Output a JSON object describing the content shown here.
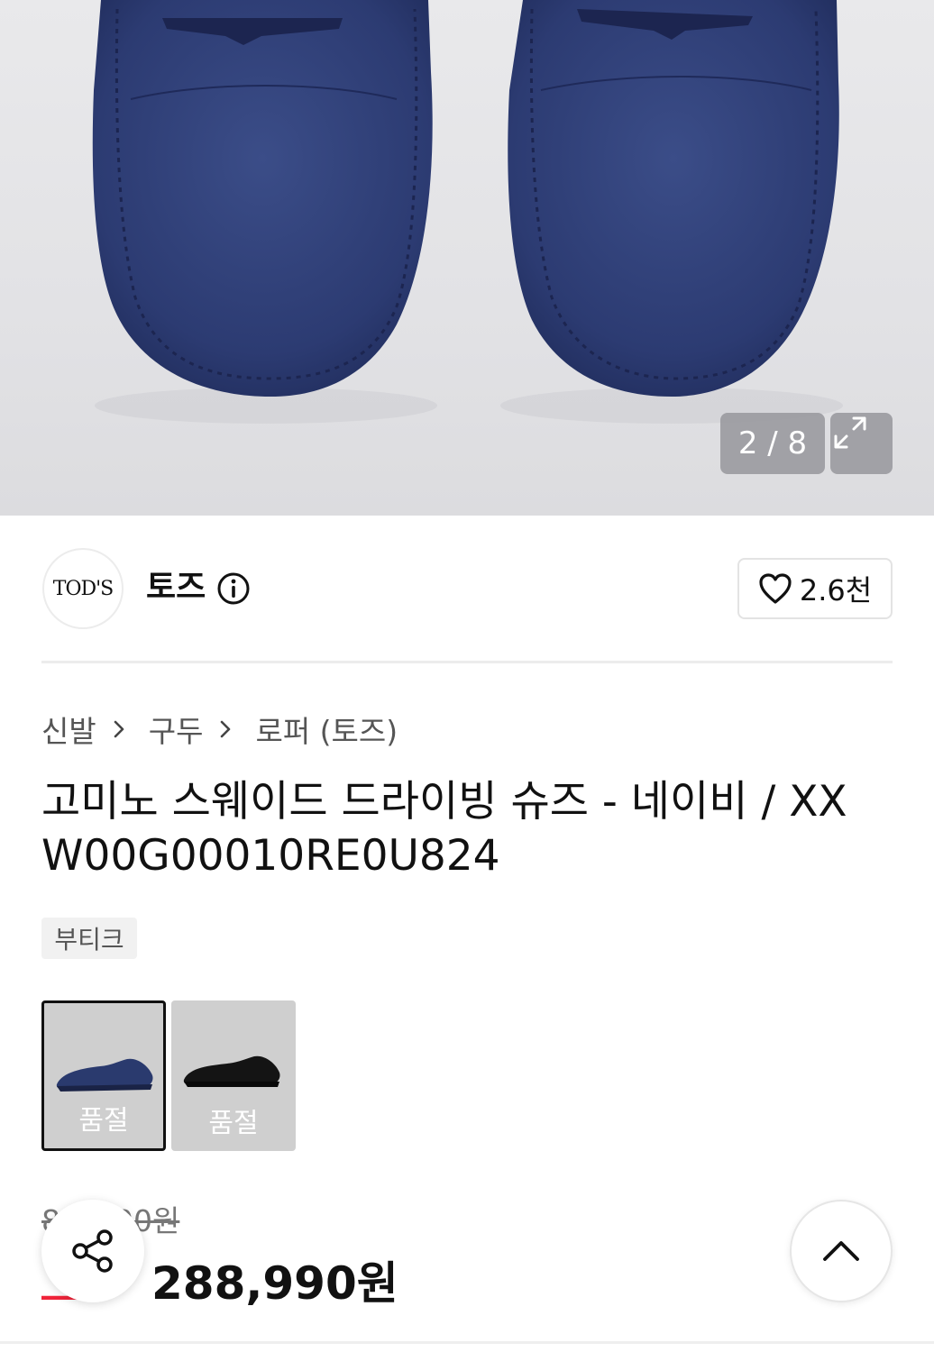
{
  "gallery": {
    "counter": "2 / 8",
    "expand_icon": "expand-arrows-icon",
    "image_alt": "navy suede loafers"
  },
  "brand": {
    "logo_text": "TOD'S",
    "name": "토즈",
    "info_icon": "info-circle-icon",
    "likes": "2.6천",
    "like_icon": "heart-outline-icon"
  },
  "breadcrumb": [
    "신발",
    "구두",
    "로퍼 (토즈)"
  ],
  "product": {
    "title_line1": "고미노 스웨이드 드라이빙 슈즈 - 네이비 / XX",
    "title_line2": "W00G00010RE0U824",
    "tag": "부티크"
  },
  "options": [
    {
      "status": "품절",
      "color": "#2a3a6e",
      "selected": true
    },
    {
      "status": "품절",
      "color": "#141414",
      "selected": false
    }
  ],
  "price": {
    "original": "8__,_00원",
    "discount": "__%",
    "current": "288,990원"
  },
  "actions": {
    "share_icon": "share-icon",
    "scroll_top_icon": "chevron-up-icon"
  },
  "colors": {
    "accent": "#f0243a",
    "navy": "#2a3a6e"
  }
}
